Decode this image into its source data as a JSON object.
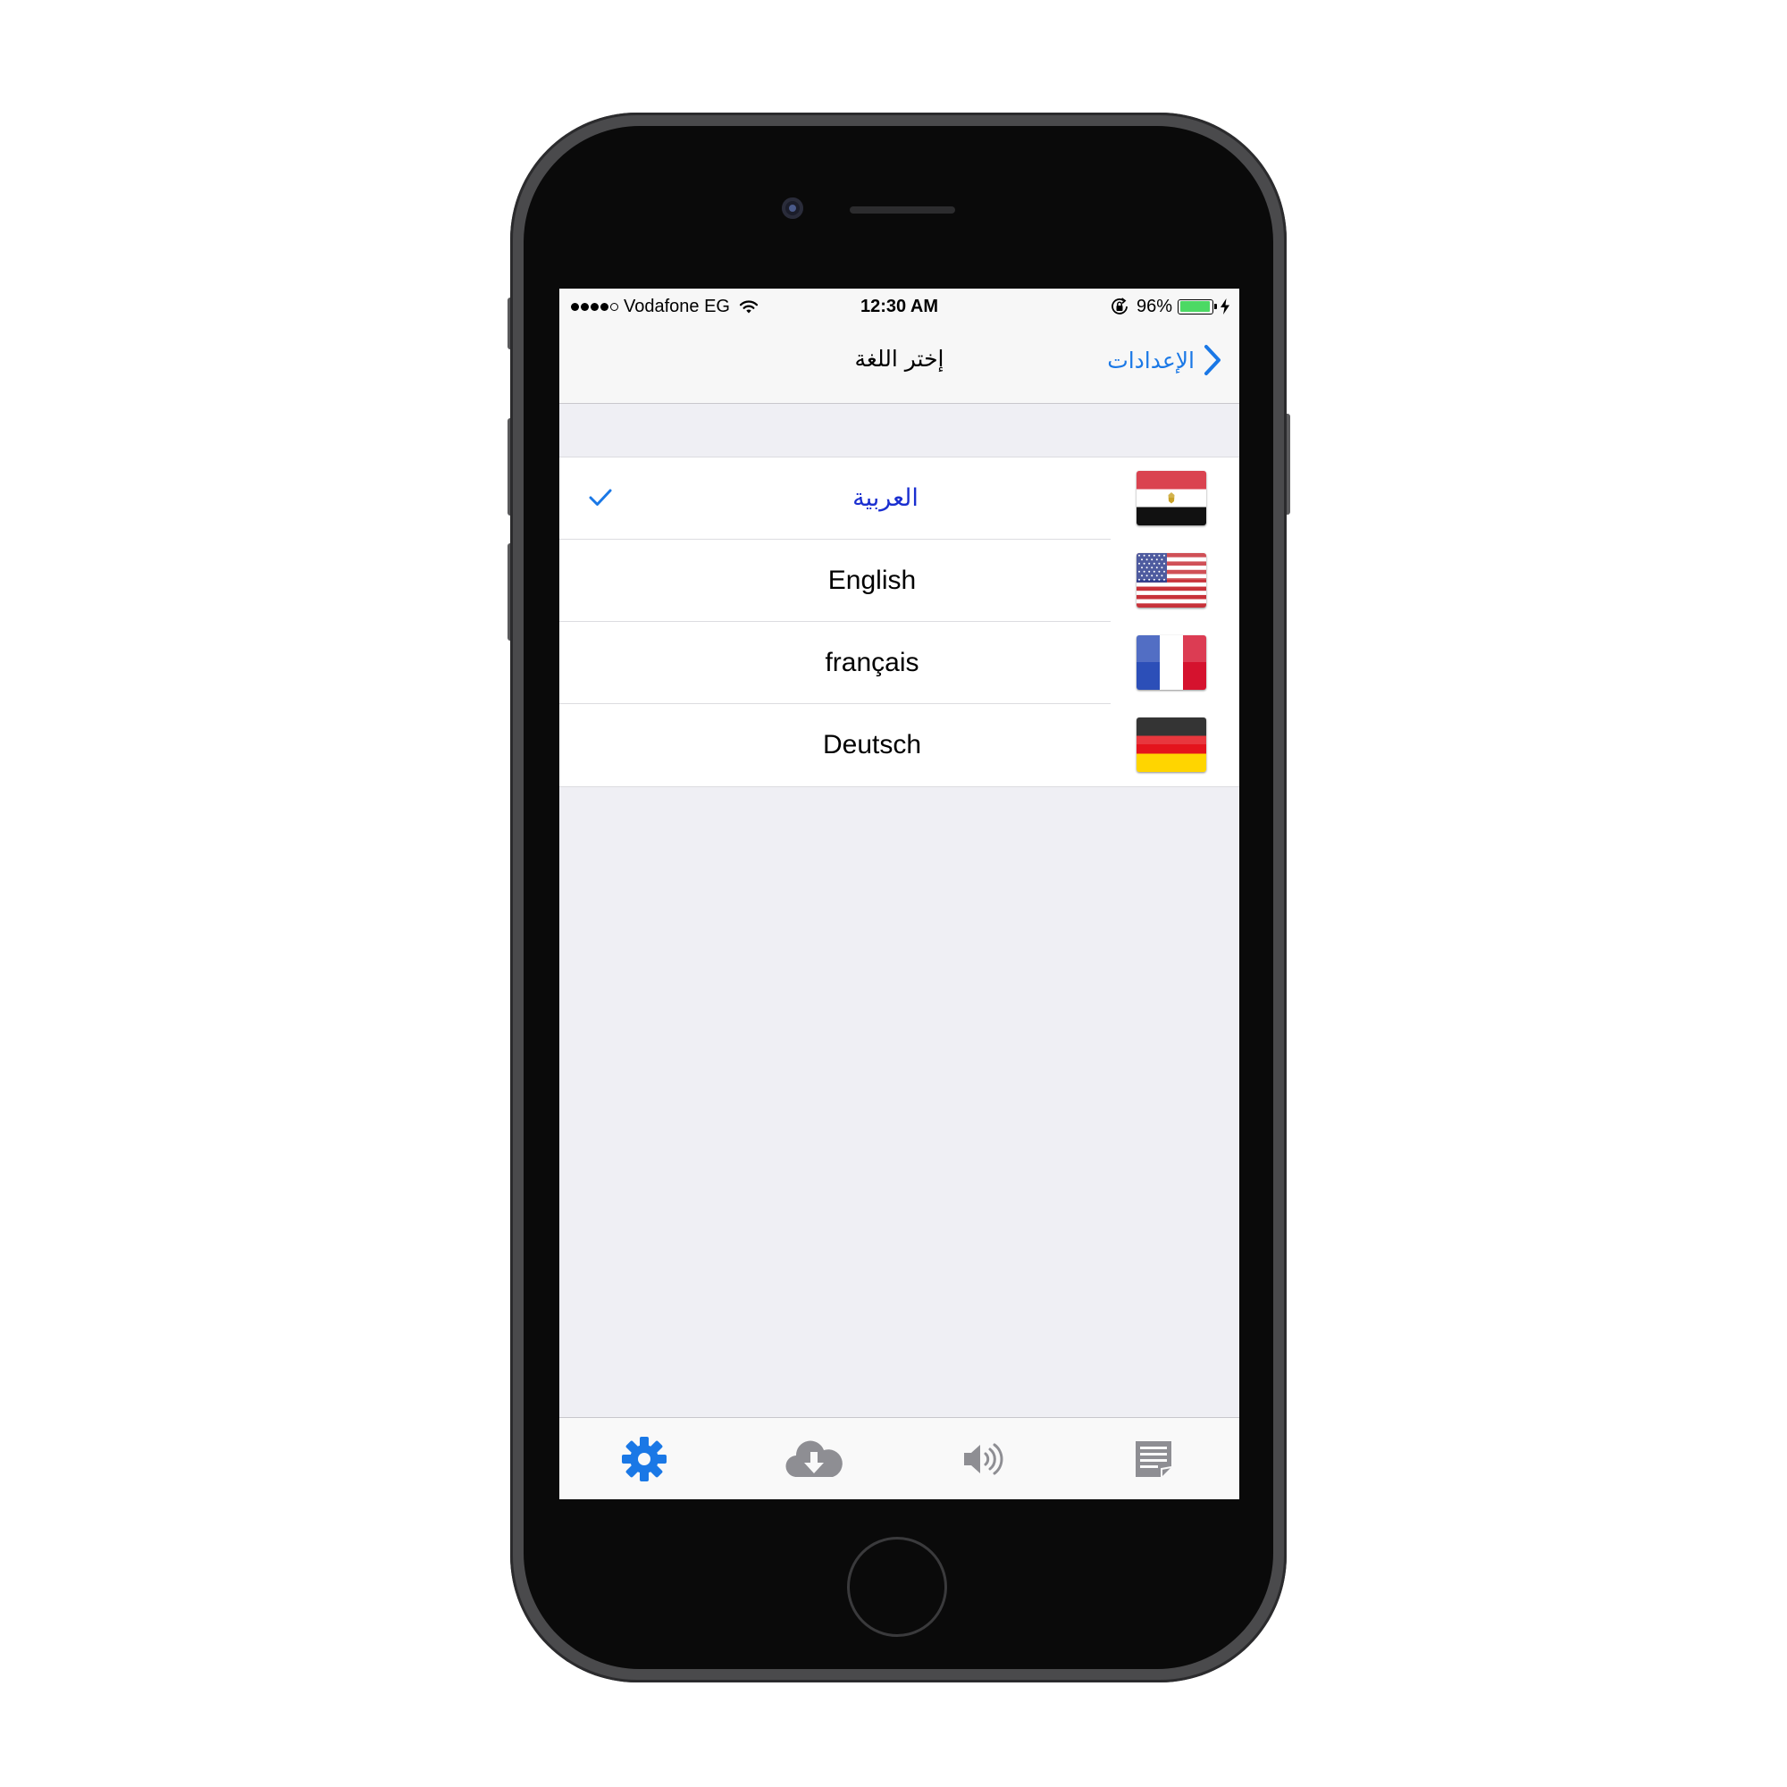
{
  "status_bar": {
    "carrier": "Vodafone EG",
    "time": "12:30 AM",
    "battery_percent_text": "96%",
    "battery_level": 0.96,
    "signal_bars_filled": 4,
    "signal_bars_total": 5
  },
  "nav": {
    "title": "إختر اللغة",
    "back_label": "الإعدادات",
    "accent_color": "#1a78e6"
  },
  "languages": [
    {
      "label": "العربية",
      "flag": "egypt-flag-icon",
      "selected": true
    },
    {
      "label": "English",
      "flag": "usa-flag-icon",
      "selected": false
    },
    {
      "label": "français",
      "flag": "france-flag-icon",
      "selected": false
    },
    {
      "label": "Deutsch",
      "flag": "germany-flag-icon",
      "selected": false
    }
  ],
  "tab_bar": {
    "items": [
      {
        "icon": "gear-icon",
        "active": true
      },
      {
        "icon": "cloud-download-icon",
        "active": false
      },
      {
        "icon": "speaker-icon",
        "active": false
      },
      {
        "icon": "notes-icon",
        "active": false
      }
    ],
    "active_color": "#1a78e6",
    "inactive_color": "#8e8e93"
  }
}
